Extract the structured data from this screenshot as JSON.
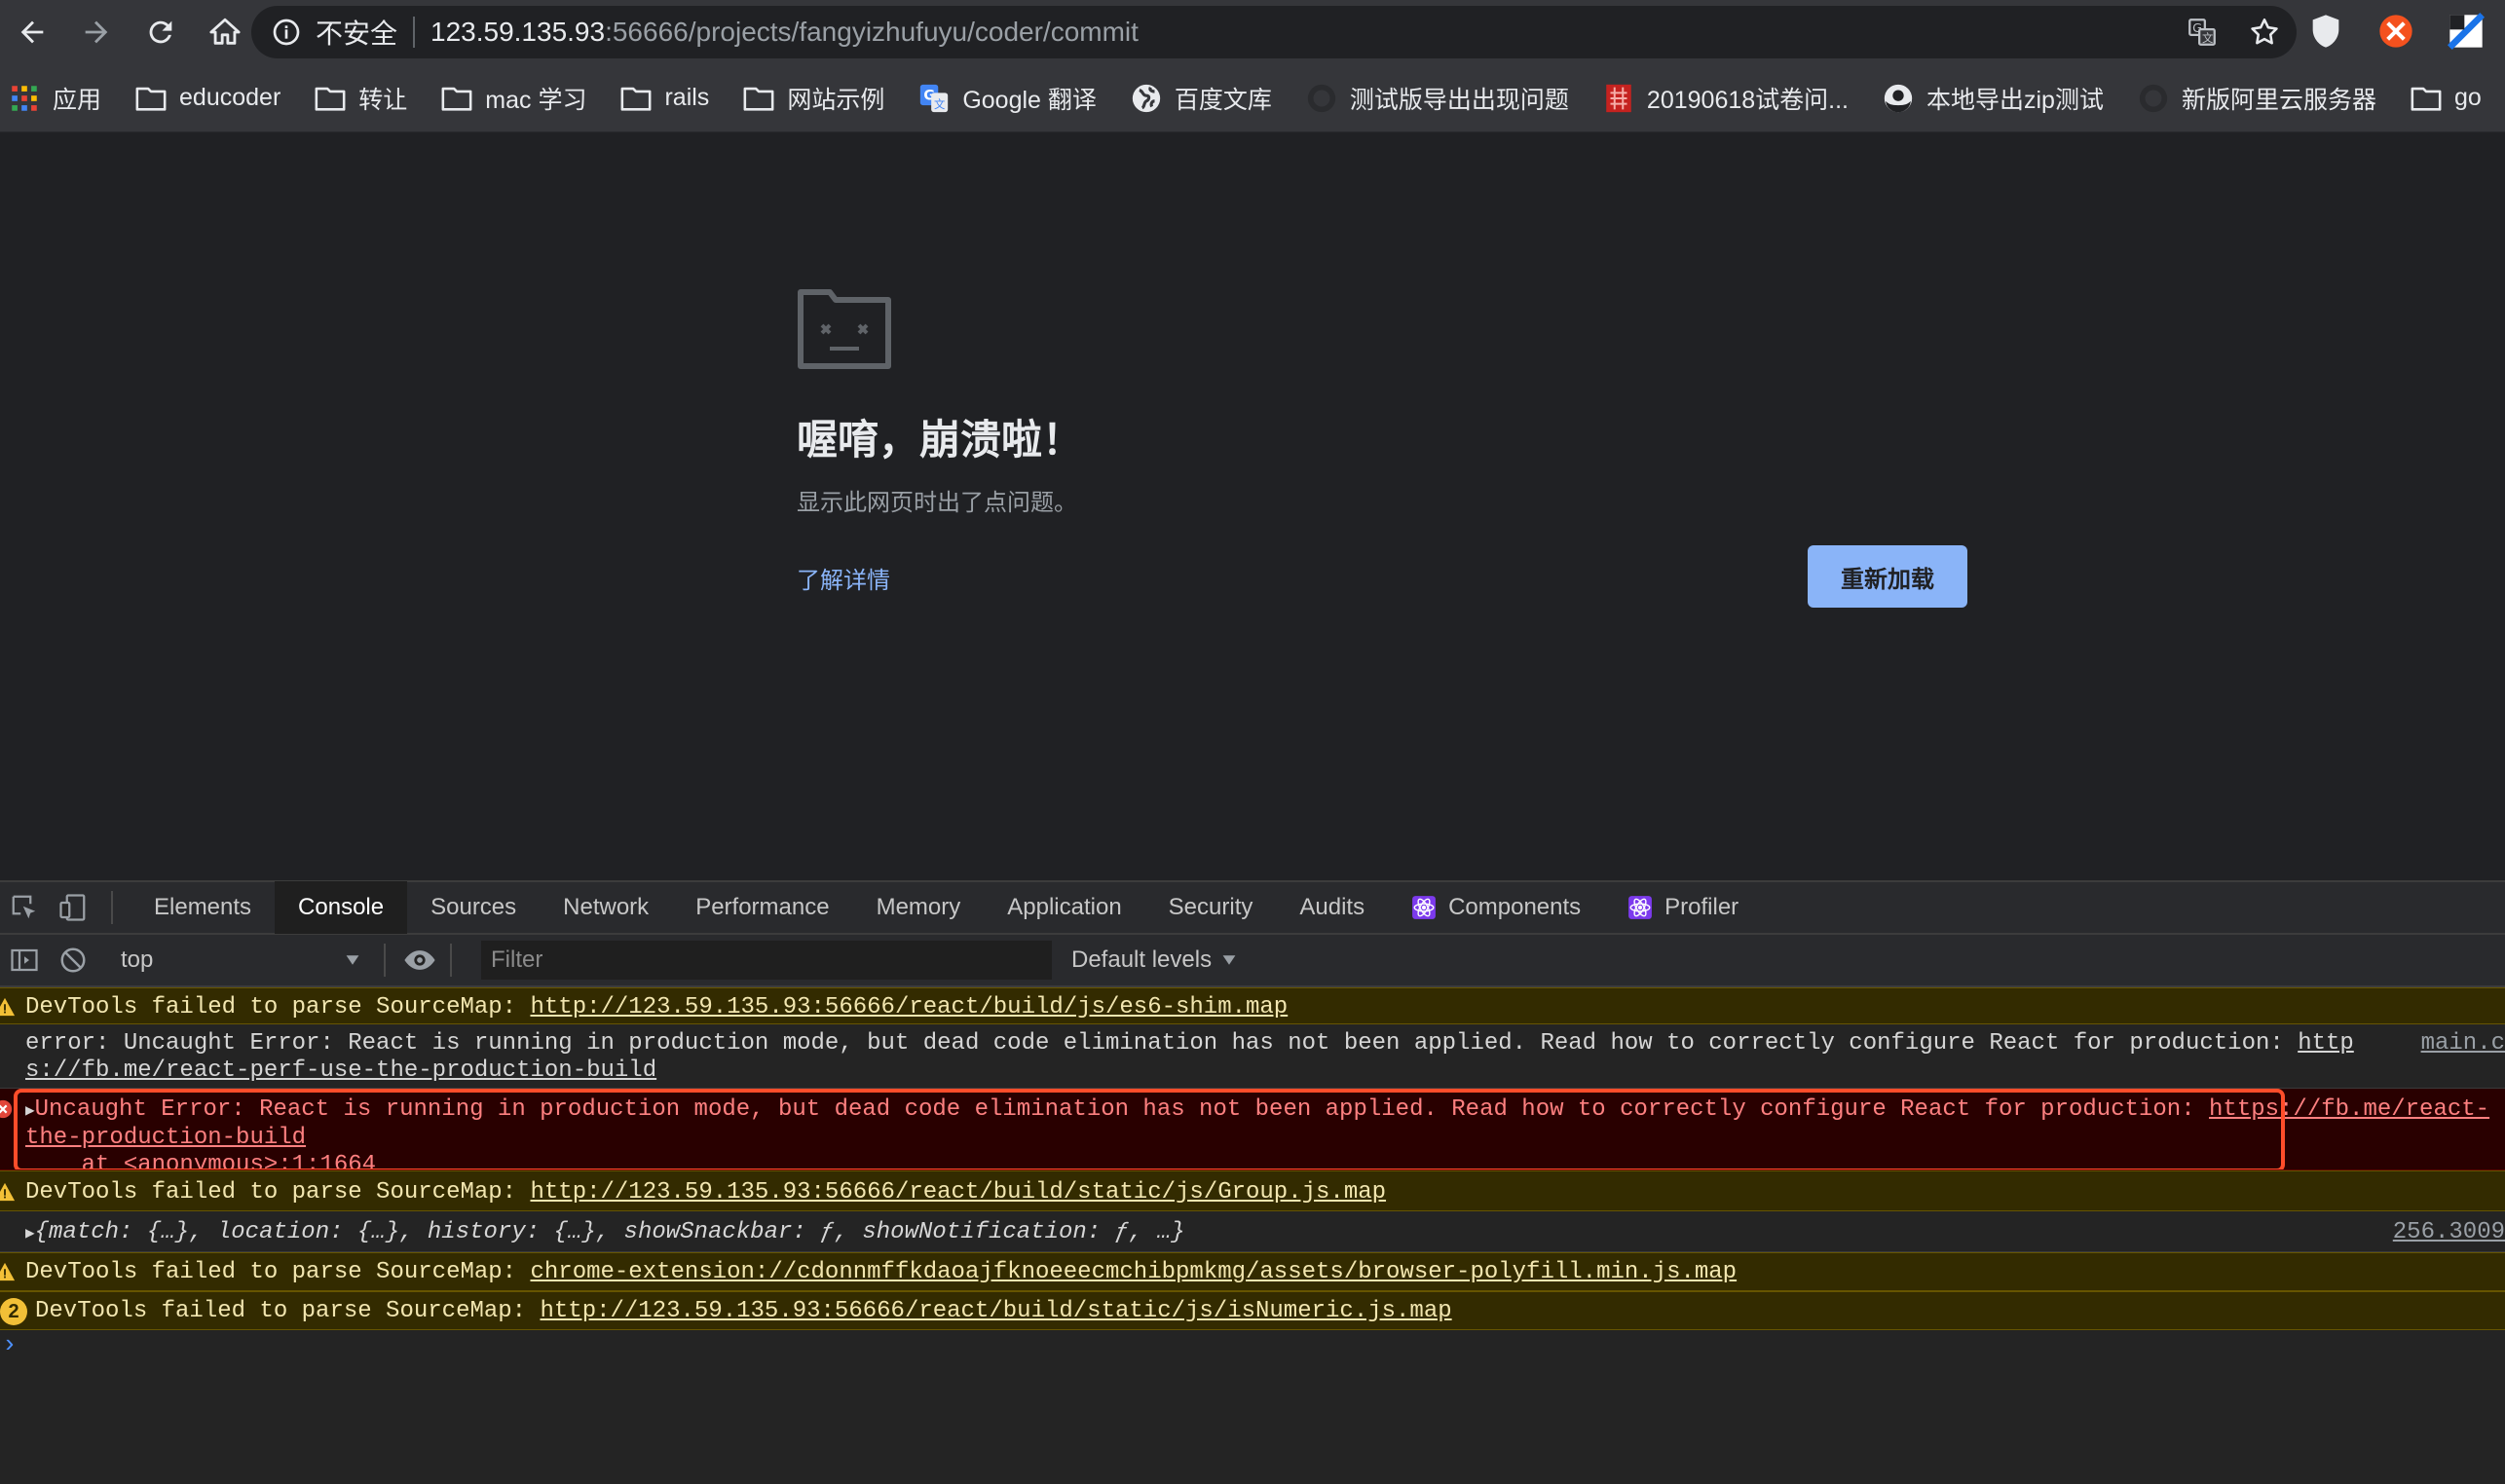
{
  "browser": {
    "not_secure_label": "不安全",
    "url_host": "123.59.135.93",
    "url_path": ":56666/projects/fangyizhufuyu/coder/commit"
  },
  "bookmarks": [
    {
      "label": "应用",
      "icon": "apps-grid-icon"
    },
    {
      "label": "educoder",
      "icon": "folder-icon"
    },
    {
      "label": "转让",
      "icon": "folder-icon"
    },
    {
      "label": "mac 学习",
      "icon": "folder-icon"
    },
    {
      "label": "rails",
      "icon": "folder-icon"
    },
    {
      "label": "网站示例",
      "icon": "folder-icon"
    },
    {
      "label": "Google 翻译",
      "icon": "google-translate-icon"
    },
    {
      "label": "百度文库",
      "icon": "globe-icon"
    },
    {
      "label": "测试版导出出现问题",
      "icon": "github-icon"
    },
    {
      "label": "20190618试卷问...",
      "icon": "red-site-icon"
    },
    {
      "label": "本地导出zip测试",
      "icon": "github-icon"
    },
    {
      "label": "新版阿里云服务器",
      "icon": "github-icon"
    },
    {
      "label": "go",
      "icon": "folder-icon"
    }
  ],
  "crash_page": {
    "title": "喔唷，崩溃啦！",
    "message": "显示此网页时出了点问题。",
    "learn_more": "了解详情",
    "reload": "重新加载"
  },
  "devtools": {
    "tabs": [
      "Elements",
      "Console",
      "Sources",
      "Network",
      "Performance",
      "Memory",
      "Application",
      "Security",
      "Audits",
      "Components",
      "Profiler"
    ],
    "active_tab": "Console",
    "context": "top",
    "filter_placeholder": "Filter",
    "levels_label": "Default levels",
    "messages": {
      "m1_text": "DevTools failed to parse SourceMap: ",
      "m1_link": "http://123.59.135.93:56666/react/build/js/es6-shim.map",
      "m2_text": "error: Uncaught Error: React is running in production mode, but dead code elimination has not been applied. Read how to correctly configure React for production: ",
      "m2_link1": "http",
      "m2_link2": "s://fb.me/react-perf-use-the-production-build",
      "m2_source": "main.c",
      "m3_text": "Uncaught Error: React is running in production mode, but dead code elimination has not been applied. Read how to correctly configure React for production: ",
      "m3_link1": "https://fb.me/react-",
      "m3_link2": "the-production-build",
      "m3_stack": "    at <anonymous>:1:1664",
      "m4_text": "DevTools failed to parse SourceMap: ",
      "m4_link": "http://123.59.135.93:56666/react/build/static/js/Group.js.map",
      "m5_text": "{match: {…}, location: {…}, history: {…}, showSnackbar: ƒ, showNotification: ƒ, …}",
      "m5_source": "256.3009",
      "m6_text": "DevTools failed to parse SourceMap: ",
      "m6_link": "chrome-extension://cdonnmffkdaoajfknoeeecmchibpmkmg/assets/browser-polyfill.min.js.map",
      "m7_count": "2",
      "m7_text": "DevTools failed to parse SourceMap: ",
      "m7_link": "http://123.59.135.93:56666/react/build/static/js/isNumeric.js.map"
    }
  }
}
